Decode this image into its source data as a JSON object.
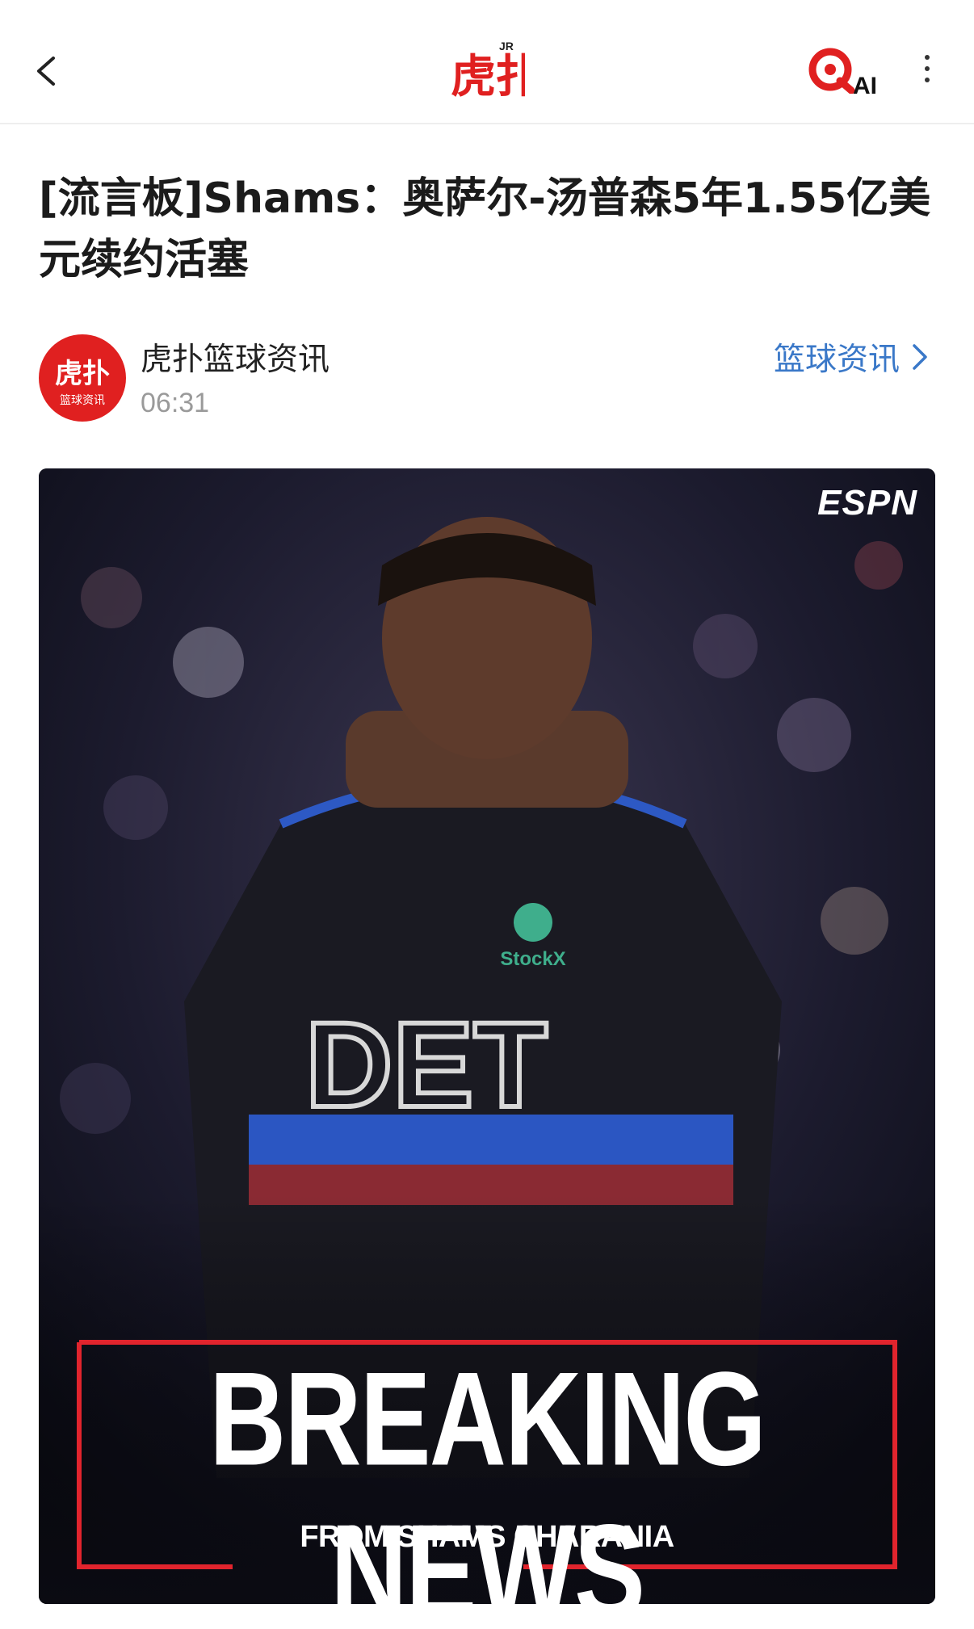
{
  "header": {
    "back_icon": "chevron-left-icon",
    "logo_text": "虎扑",
    "logo_badge": "JR",
    "ai_label": "AI",
    "more_icon": "more-vertical-icon"
  },
  "article": {
    "title": "[流言板]Shams：奥萨尔-汤普森5年1.55亿美元续约活塞"
  },
  "author": {
    "avatar_text_top": "虎扑",
    "avatar_text_bottom": "篮球资讯",
    "name": "虎扑篮球资讯",
    "time": "06:31",
    "category_link": "篮球资讯"
  },
  "hero_image": {
    "network_logo": "ESPN",
    "jersey_text": "DET",
    "sponsor_text": "StockX",
    "headline": "BREAKING NEWS",
    "subheadline": "FROM SHAMS CHARANIA"
  },
  "colors": {
    "brand_red": "#e02020",
    "link_blue": "#3a78c8",
    "title_text": "#1b1b1b",
    "muted_text": "#9a9a9a"
  }
}
